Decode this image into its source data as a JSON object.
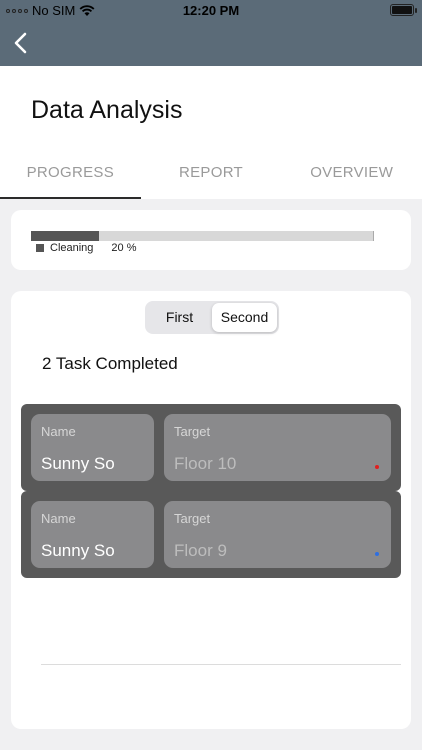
{
  "status_bar": {
    "carrier": "No SIM",
    "time": "12:20 PM"
  },
  "nav": {
    "back_icon": "chevron-left-icon"
  },
  "page": {
    "title": "Data Analysis"
  },
  "tabs": [
    {
      "label": "PROGRESS",
      "active": true
    },
    {
      "label": "REPORT",
      "active": false
    },
    {
      "label": "OVERVIEW",
      "active": false
    }
  ],
  "progress_card": {
    "label": "Cleaning",
    "percent_text": "20 %",
    "value": 0.2,
    "fill_color": "#555555"
  },
  "segment": {
    "first": "First",
    "second": "Second",
    "selected": "Second"
  },
  "tasks_summary": "2 Task Completed",
  "tasks": [
    {
      "name_label": "Name",
      "name": "Sunny So",
      "target_label": "Target",
      "target": "Floor 10",
      "dot_color": "#e02020"
    },
    {
      "name_label": "Name",
      "name": "Sunny So",
      "target_label": "Target",
      "target": "Floor 9",
      "dot_color": "#2f6fe0"
    }
  ]
}
